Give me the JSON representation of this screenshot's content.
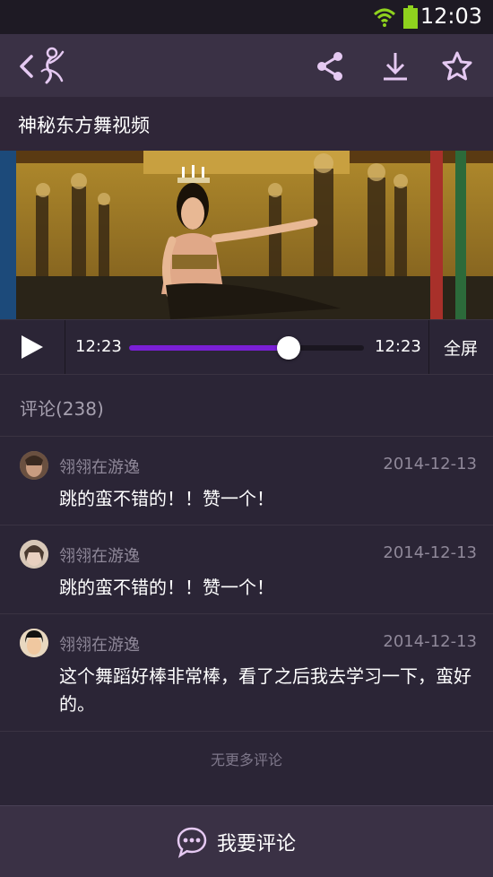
{
  "status_bar": {
    "time": "12:03",
    "wifi_icon": "wifi-icon",
    "battery_icon": "battery-icon"
  },
  "toolbar": {
    "back_icon": "back-icon",
    "logo_icon": "dancer-logo-icon",
    "share_icon": "share-icon",
    "download_icon": "download-icon",
    "favorite_icon": "star-icon"
  },
  "video": {
    "title": "神秘东方舞视频",
    "current_time": "12:23",
    "total_time": "12:23",
    "progress": 0.68,
    "fullscreen_label": "全屏",
    "play_icon": "play-icon"
  },
  "comments": {
    "header": "评论(238)",
    "items": [
      {
        "user": "翎翎在游逸",
        "date": "2014-12-13",
        "text": "跳的蛮不错的！！赞一个！"
      },
      {
        "user": "翎翎在游逸",
        "date": "2014-12-13",
        "text": "跳的蛮不错的！！赞一个！"
      },
      {
        "user": "翎翎在游逸",
        "date": "2014-12-13",
        "text": "这个舞蹈好棒非常棒，看了之后我去学习一下，蛮好的。"
      }
    ],
    "no_more": "无更多评论"
  },
  "bottom": {
    "comment_label": "我要评论",
    "comment_icon": "speech-bubble-icon"
  },
  "colors": {
    "accent": "#7a1fd6",
    "toolbar": "#3a3145",
    "background": "#2b2536",
    "icon_tint": "#e5c9f2"
  }
}
